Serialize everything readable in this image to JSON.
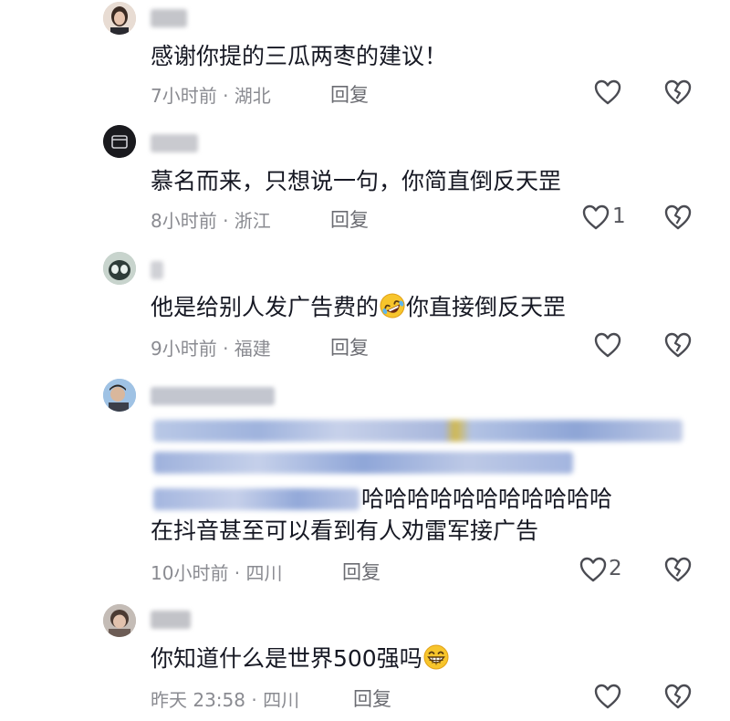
{
  "comments": [
    {
      "text": "感谢你提的三瓜两枣的建议！",
      "time": "7小时前 · 湖北",
      "reply": "回复",
      "likes": ""
    },
    {
      "text": "慕名而来，只想说一句，你简直倒反天罡",
      "time": "8小时前 · 浙江",
      "reply": "回复",
      "likes": "1"
    },
    {
      "text_before_emoji": "他是给别人发广告费的",
      "emoji": "rolling-on-floor-laughing-emoji",
      "text_after_emoji": "你直接倒反天罡",
      "time": "9小时前 · 福建",
      "reply": "回复",
      "likes": ""
    },
    {
      "text_line3_visible": "哈哈哈哈哈哈哈哈哈哈哈",
      "text_line4": "在抖音甚至可以看到有人劝雷军接广告",
      "time": "10小时前 · 四川",
      "reply": "回复",
      "likes": "2"
    },
    {
      "text_before_emoji": "你知道什么是世界500强吗",
      "emoji": "grinning-face-emoji",
      "time": "昨天 23:58 · 四川",
      "reply": "回复",
      "likes": ""
    }
  ],
  "icons": {
    "like": "heart-outline-icon",
    "dislike": "broken-heart-outline-icon"
  },
  "colors": {
    "text": "#161823",
    "meta": "#8a8b91",
    "mention": "#3a5a9a"
  }
}
